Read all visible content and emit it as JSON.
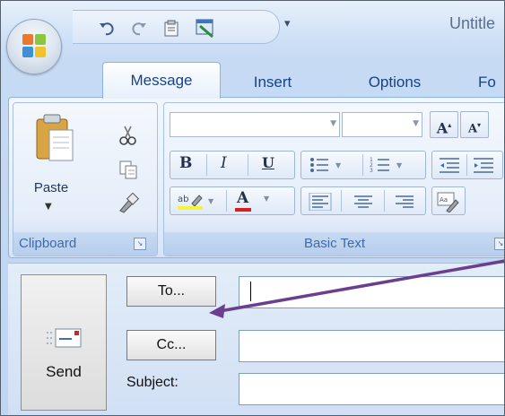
{
  "window": {
    "title": "Untitle"
  },
  "quick_access": {
    "icons": [
      "undo-icon",
      "redo-icon",
      "clipboard-icon",
      "window-icon"
    ],
    "more_label": "▾"
  },
  "tabs": [
    {
      "label": "Message",
      "selected": true
    },
    {
      "label": "Insert"
    },
    {
      "label": "Options"
    },
    {
      "label": "Fo"
    }
  ],
  "ribbon": {
    "clipboard": {
      "group_label": "Clipboard",
      "paste_label": "Paste",
      "tools": [
        "cut-icon",
        "copy-icon",
        "format-painter-icon"
      ]
    },
    "basic_text": {
      "group_label": "Basic Text",
      "font_name": "",
      "font_size": "",
      "grow_font": "A",
      "shrink_font": "A",
      "bold": "B",
      "italic": "I",
      "underline": "U",
      "font_color": "A"
    }
  },
  "compose": {
    "send_label": "Send",
    "to_button": "To...",
    "cc_button": "Cc...",
    "subject_label": "Subject:",
    "to_value": "",
    "cc_value": "",
    "subject_value": ""
  },
  "colors": {
    "accent": "#15428b",
    "ribbon_bg": "#dfe9f7",
    "annotation_arrow": "#6b3f8f"
  }
}
